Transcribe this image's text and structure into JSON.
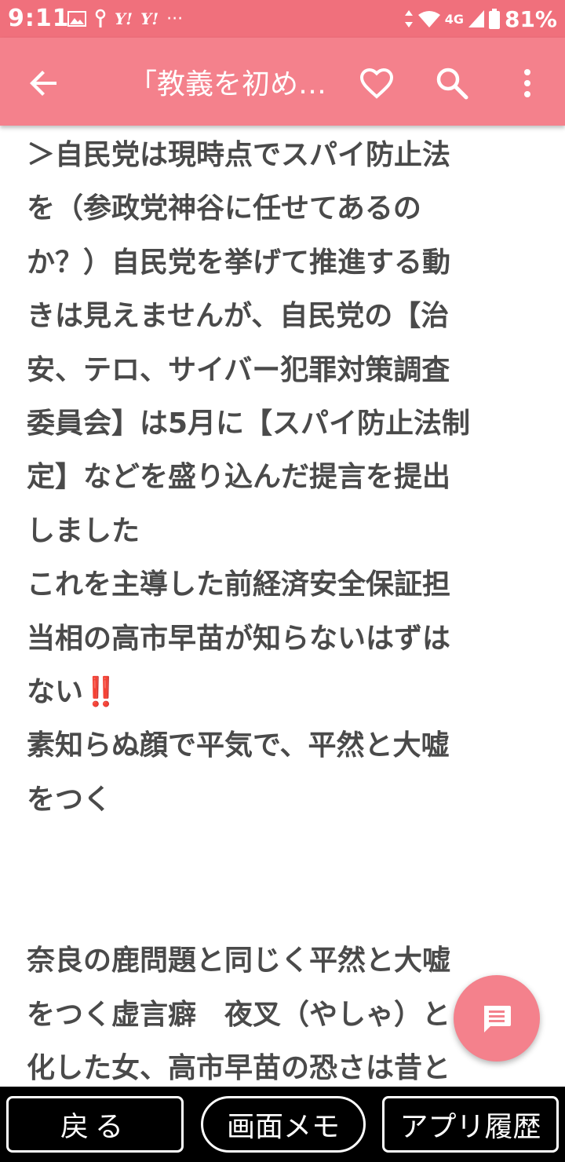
{
  "status_bar": {
    "time": "9:11",
    "network": "4G",
    "battery": "81%",
    "yahoo_icons": [
      "Y!",
      "Y!"
    ],
    "overflow": "···"
  },
  "app_bar": {
    "title": "「教義を初め…"
  },
  "article": {
    "text": "＞自民党は現時点でスパイ防止法\nを（参政党神谷に任せてあるの\nか？）自民党を挙げて推進する動\nきは見えませんが、自民党の【治\n安、テロ、サイバー犯罪対策調査\n委員会】は5月に【スパイ防止法制\n定】などを盛り込んだ提言を提出\nしました\nこれを主導した前経済安全保証担\n当相の高市早苗が知らないはずは\nない‼️\n素知らぬ顔で平気で、平然と大嘘\nをつく\n\n\n奈良の鹿問題と同じく平然と大嘘\nをつく虚言癖　夜叉（やしゃ）と\n化した女、高市早苗の恐さは昔と\nは違った、"
  },
  "bottom_bar": {
    "back_label": "戻る",
    "memo_label": "画面メモ",
    "history_label": "アプリ履歴"
  },
  "colors": {
    "status_bar": "#f0707c",
    "app_bar": "#f4818c",
    "fab": "#f4818c",
    "text": "#4a4a4a",
    "bottom_bar": "#000000"
  }
}
